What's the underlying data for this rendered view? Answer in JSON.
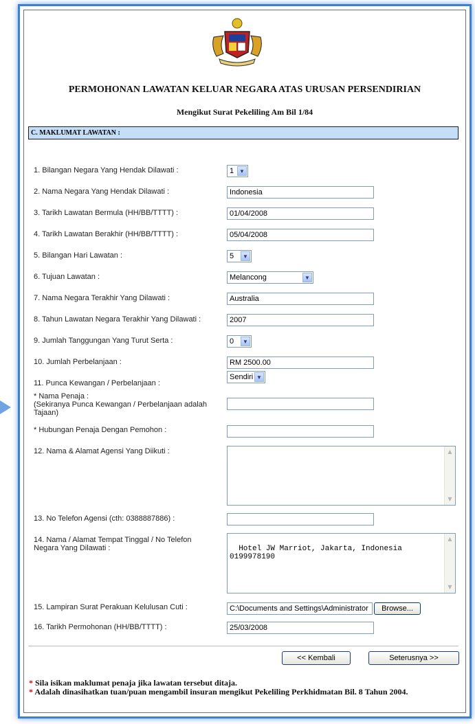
{
  "crest_icon": "malaysia-coat-of-arms",
  "header": {
    "title": "PERMOHONAN LAWATAN KELUAR NEGARA ATAS URUSAN PERSENDIRIAN",
    "subtitle": "Mengikut Surat Pekeliling Am Bil 1/84"
  },
  "section": {
    "heading": "C. MAKLUMAT LAWATAN :"
  },
  "fields": {
    "q1": {
      "label": "1. Bilangan Negara Yang Hendak Dilawati :",
      "value": "1"
    },
    "q2": {
      "label": "2. Nama Negara Yang Hendak Dilawati :",
      "value": "Indonesia"
    },
    "q3": {
      "label": "3. Tarikh Lawatan Bermula (HH/BB/TTTT) :",
      "value": "01/04/2008"
    },
    "q4": {
      "label": "4. Tarikh Lawatan Berakhir (HH/BB/TTTT) :",
      "value": "05/04/2008"
    },
    "q5": {
      "label": "5. Bilangan Hari Lawatan :",
      "value": "5"
    },
    "q6": {
      "label": "6. Tujuan Lawatan :",
      "value": "Melancong"
    },
    "q7": {
      "label": "7. Nama Negara Terakhir Yang Dilawati :",
      "value": "Australia"
    },
    "q8": {
      "label": "8. Tahun Lawatan Negara Terakhir Yang Dilawati :",
      "value": "2007"
    },
    "q9": {
      "label": "9. Jumlah Tanggungan Yang Turut Serta :",
      "value": "0"
    },
    "q10": {
      "label": "10. Jumlah Perbelanjaan :",
      "value": "RM 2500.00"
    },
    "q11": {
      "label": "11. Punca Kewangan / Perbelanjaan :",
      "value": "Sendiri"
    },
    "penaja_nama": {
      "label_line1": "* Nama Penaja :",
      "label_line2": "(Sekiranya Punca Kewangan / Perbelanjaan adalah",
      "label_line3": "Tajaan)",
      "value": ""
    },
    "penaja_hubungan": {
      "label": "* Hubungan Penaja Dengan Pemohon :",
      "value": ""
    },
    "q12": {
      "label": "12. Nama & Alamat Agensi Yang Diikuti :",
      "value": ""
    },
    "q13": {
      "label": "13. No Telefon Agensi (cth: 0388887886) :",
      "value": ""
    },
    "q14": {
      "label_line1": "14. Nama / Alamat Tempat Tinggal / No Telefon",
      "label_line2": "Negara Yang Dilawati :",
      "value": "Hotel JW Marriot, Jakarta, Indonesia\n0199978190"
    },
    "q15": {
      "label": "15. Lampiran Surat Perakuan Kelulusan Cuti :",
      "value": "C:\\Documents and Settings\\Administrator",
      "browse_label": "Browse..."
    },
    "q16": {
      "label": "16. Tarikh Permohonan (HH/BB/TTTT) :",
      "value": "25/03/2008"
    }
  },
  "buttons": {
    "back": "<< Kembali",
    "next": "Seterusnya >>"
  },
  "notes": {
    "star": "*",
    "note1": "Sila isikan maklumat penaja jika lawatan tersebut ditaja.",
    "note2": "Adalah dinasihatkan tuan/puan mengambil insuran mengikut Pekeliling Perkhidmatan Bil. 8 Tahun 2004."
  },
  "colors": {
    "frame": "#3f7fd0",
    "section_bg": "#c4def8",
    "asterisk": "#d01010"
  }
}
